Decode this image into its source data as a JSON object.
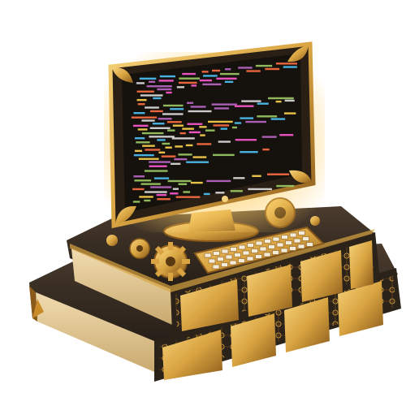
{
  "scene": {
    "subject": "ornate-monitor-on-books",
    "colors": {
      "background": "#ffffff",
      "gold": "#d9a441",
      "gold_light": "#f6d27a",
      "gold_dark": "#8a5a1a",
      "leather": "#3a2e24",
      "leather_dark": "#1f1913",
      "pages": "#e9d3a6",
      "screen_bg": "#15110c",
      "glow": "#ffcf66"
    },
    "code_colors": [
      "#4fc3f7",
      "#ff5ad1",
      "#ffd54f",
      "#ff7043",
      "#9ccc65",
      "#e0e0e0",
      "#ba68c8"
    ]
  }
}
